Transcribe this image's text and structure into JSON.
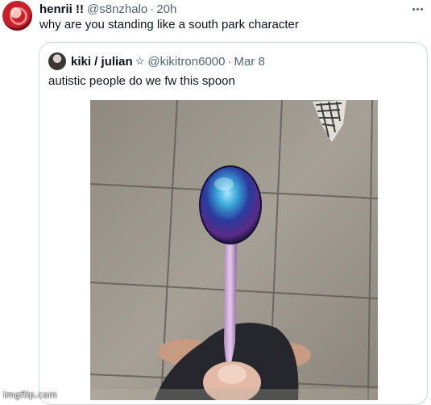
{
  "tweet": {
    "display_name": "henrii !!",
    "handle": "@s8nzhalo",
    "separator": "·",
    "time": "20h",
    "text": "why are you standing like a south park character"
  },
  "quoted_tweet": {
    "display_name": "kiki / julian",
    "badge": "☆",
    "handle": "@kikitron6000",
    "separator": "·",
    "time": "Mar 8",
    "text": "autistic people do we fw this spoon"
  },
  "icons": {
    "more": "more-horizontal-icon"
  },
  "watermark": "imgflip.com",
  "colors": {
    "text_primary": "#0f1419",
    "text_secondary": "#536471",
    "border": "#cfd9de"
  }
}
